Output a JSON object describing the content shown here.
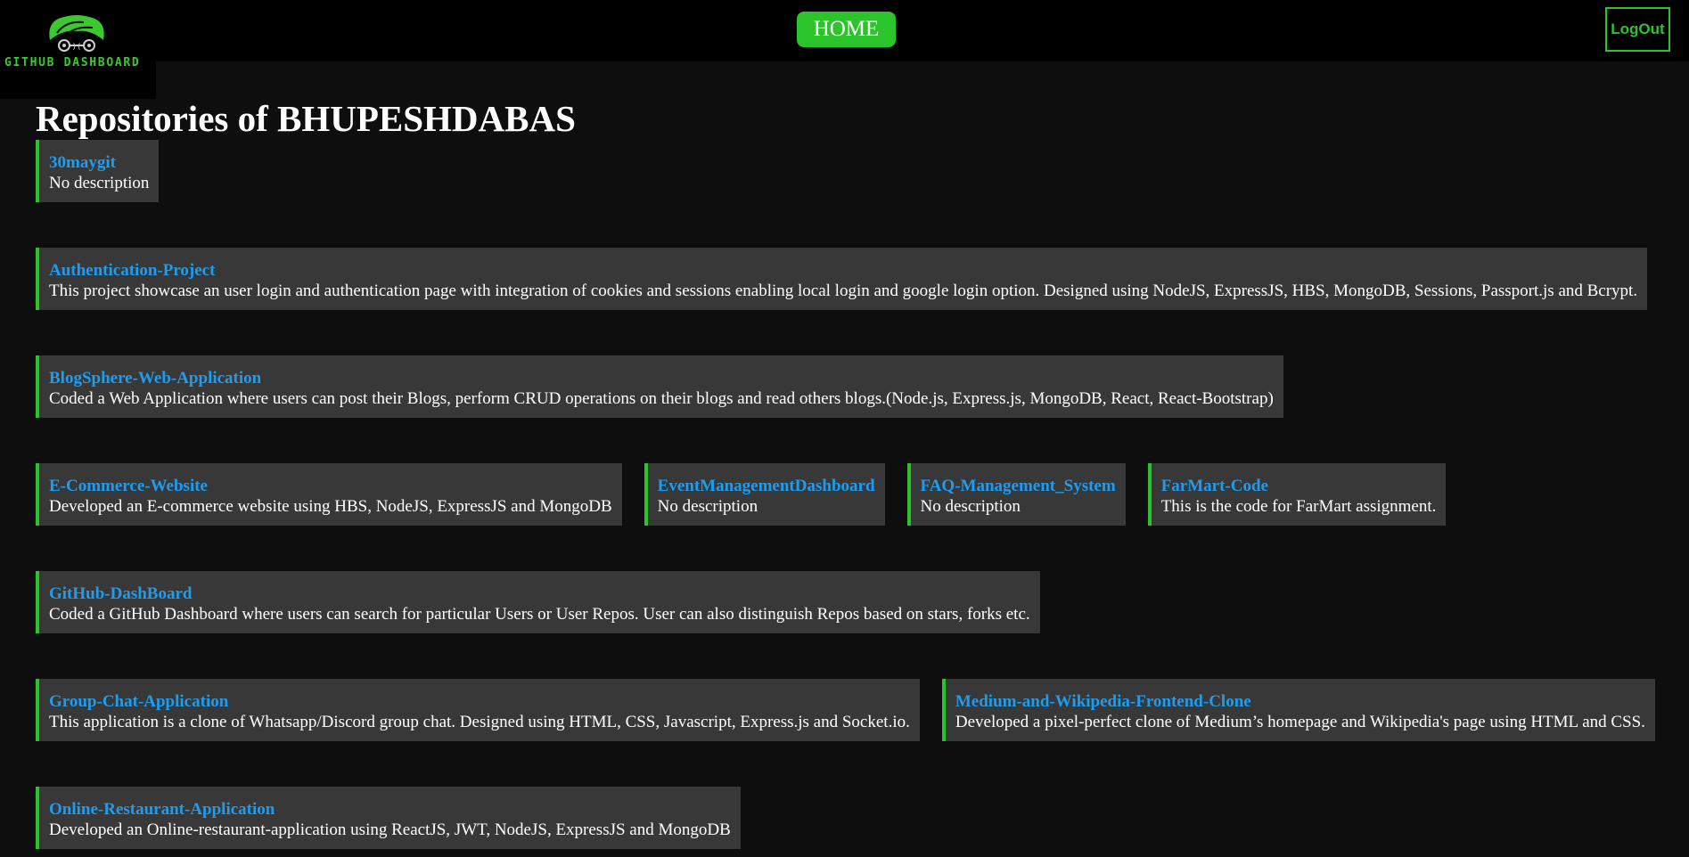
{
  "logo": {
    "text": "GITHUB DASHBOARD",
    "icon": "github-octocat-glasses-icon"
  },
  "nav": {
    "home_label": "HOME",
    "logout_label": "LogOut"
  },
  "page": {
    "title": "Repositories of BHUPESHDABAS"
  },
  "colors": {
    "accent": "#2bc42b",
    "link": "#1e9cf0",
    "card_bg": "#383838",
    "page_bg": "#0e0e0e"
  },
  "repos": [
    {
      "name": "30maygit",
      "description": "No description"
    },
    {
      "name": "Authentication-Project",
      "description": "This project showcase an user login and authentication page with integration of cookies and sessions enabling local login and google login option. Designed using NodeJS, ExpressJS, HBS, MongoDB, Sessions, Passport.js and Bcrypt."
    },
    {
      "name": "BlogSphere-Web-Application",
      "description": "Coded a Web Application where users can post their Blogs, perform CRUD operations on their blogs and read others blogs.(Node.js, Express.js, MongoDB, React, React-Bootstrap)"
    },
    {
      "name": "E-Commerce-Website",
      "description": "Developed an E-commerce website using HBS, NodeJS, ExpressJS and MongoDB"
    },
    {
      "name": "EventManagementDashboard",
      "description": "No description"
    },
    {
      "name": "FAQ-Management_System",
      "description": "No description"
    },
    {
      "name": "FarMart-Code",
      "description": "This is the code for FarMart assignment."
    },
    {
      "name": "GitHub-DashBoard",
      "description": "Coded a GitHub Dashboard where users can search for particular Users or User Repos. User can also distinguish Repos based on stars, forks etc."
    },
    {
      "name": "Group-Chat-Application",
      "description": "This application is a clone of Whatsapp/Discord group chat. Designed using HTML, CSS, Javascript, Express.js and Socket.io."
    },
    {
      "name": "Medium-and-Wikipedia-Frontend-Clone",
      "description": "Developed a pixel-perfect clone of Medium’s homepage and Wikipedia's page using HTML and CSS."
    },
    {
      "name": "Online-Restaurant-Application",
      "description": "Developed an Online-restaurant-application using ReactJS, JWT, NodeJS, ExpressJS and MongoDB"
    }
  ]
}
